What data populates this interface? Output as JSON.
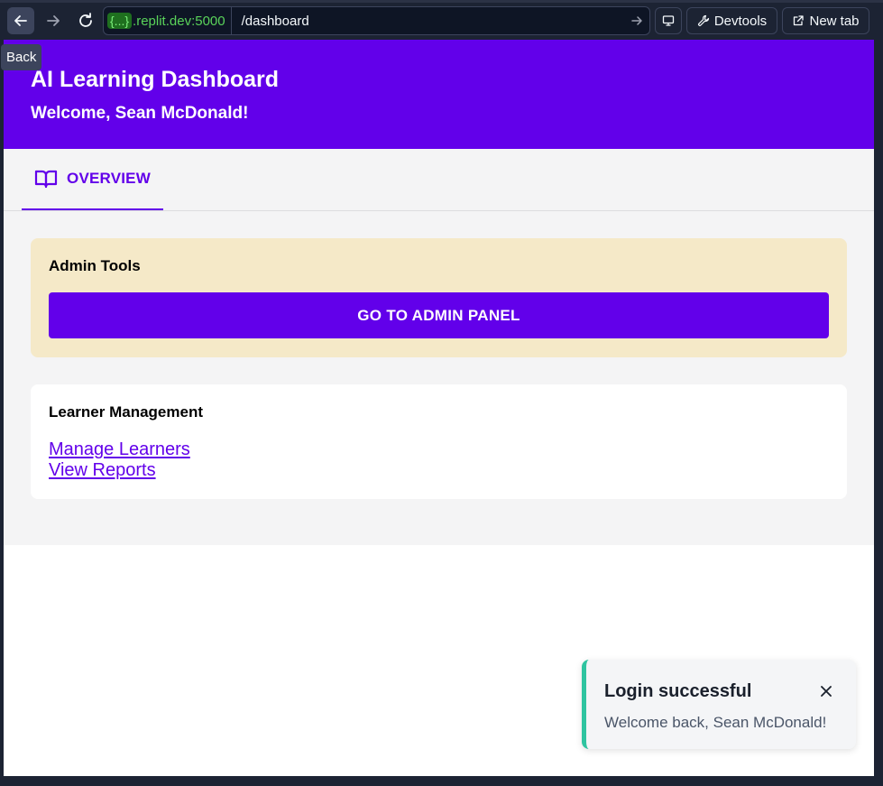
{
  "browser": {
    "tooltip": "Back",
    "url_badge": "{...}",
    "url_host": ".replit.dev:5000",
    "url_path": "/dashboard",
    "devtools_label": "Devtools",
    "newtab_label": "New tab",
    "icons": [
      "arrow-left-icon",
      "arrow-right-icon",
      "reload-icon",
      "arrow-right-icon",
      "monitor-icon",
      "wrench-icon",
      "external-link-icon"
    ]
  },
  "header": {
    "title": "AI Learning Dashboard",
    "welcome": "Welcome, Sean McDonald!"
  },
  "tabs": [
    {
      "label": "OVERVIEW",
      "icon": "book-open-icon",
      "active": true
    }
  ],
  "admin_card": {
    "title": "Admin Tools",
    "button_label": "GO TO ADMIN PANEL"
  },
  "learner_card": {
    "title": "Learner Management",
    "links": [
      "Manage Learners",
      "View Reports"
    ]
  },
  "toast": {
    "title": "Login successful",
    "message": "Welcome back, Sean McDonald!"
  },
  "colors": {
    "primary": "#6200ea",
    "admin_card_bg": "#f5e9c8",
    "toast_accent": "#2ec4a0",
    "chrome_bg": "#1c2333"
  }
}
